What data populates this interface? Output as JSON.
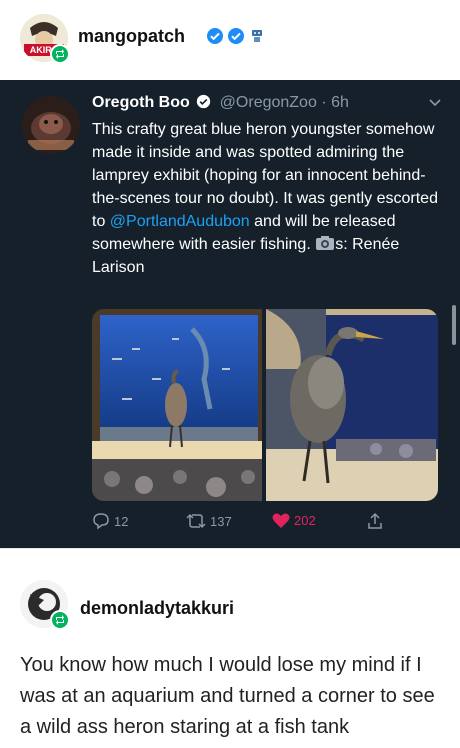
{
  "reblog": {
    "username": "mangopatch",
    "avatar_text": "AKIRA",
    "badges": [
      "verified-badge-blue",
      "verified-badge-blue",
      "robot-badge"
    ]
  },
  "tweet": {
    "name": "Oregoth Boo",
    "handle": "@OregonZoo",
    "time": "· 6h",
    "text_before": "This crafty great blue heron youngster somehow made it inside and was spotted admiring the lamprey exhibit (hoping for an innocent behind-the-scenes tour no doubt). It was gently escorted to ",
    "link": "@PortlandAudubon",
    "text_after": " and will be released somewhere with easier fishing. ",
    "credit": "s: Renée Larison",
    "stats": {
      "replies": "12",
      "retweets": "137",
      "likes": "202"
    },
    "colors": {
      "background": "#15202b",
      "link": "#1da1f2",
      "like": "#e0245e",
      "muted": "#8899a6"
    }
  },
  "reply": {
    "username": "demonladytakkuri",
    "body": "You know how much I would lose my mind if I was at an aquarium and turned a corner to see a wild ass heron staring at a fish tank"
  },
  "icons": [
    "reblog-icon",
    "verified-icon",
    "chevron-down-icon",
    "camera-icon",
    "reply-icon",
    "retweet-icon",
    "heart-icon",
    "share-icon"
  ]
}
